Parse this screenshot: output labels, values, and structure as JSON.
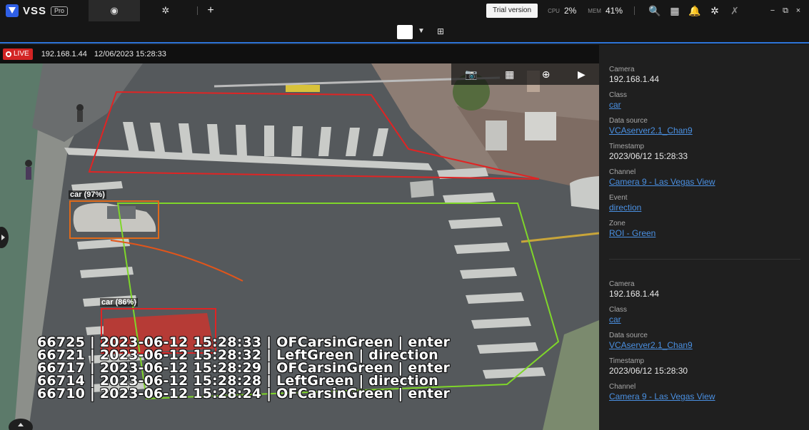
{
  "app": {
    "name": "VSS",
    "edition": "Pro",
    "trial_label": "Trial version",
    "cpu_label": "CPU",
    "cpu_value": "2%",
    "mem_label": "MEM",
    "mem_value": "41%",
    "add_tab_label": "+",
    "accent_color": "#2d74d8"
  },
  "tabs": [
    {
      "icon": "eye-icon",
      "glyph": "◉",
      "active": true
    },
    {
      "icon": "gear-icon",
      "glyph": "✲",
      "active": false
    }
  ],
  "toolbar_icons": [
    {
      "name": "search-icon",
      "glyph": "🔍"
    },
    {
      "name": "grid-icon",
      "glyph": "▦"
    },
    {
      "name": "bell-icon",
      "glyph": "🔔"
    },
    {
      "name": "settings-icon",
      "glyph": "✲"
    },
    {
      "name": "pin-icon",
      "glyph": "✗"
    }
  ],
  "window_controls": [
    {
      "name": "minimize-icon",
      "glyph": "−"
    },
    {
      "name": "restore-icon",
      "glyph": "⧉"
    },
    {
      "name": "close-icon",
      "glyph": "×"
    }
  ],
  "video": {
    "live_label": "LIVE",
    "camera_ip": "192.168.1.44",
    "datetime": "12/06/2023 15:28:33",
    "detections": [
      {
        "label": "car (97%)"
      },
      {
        "label": "car (86%)"
      }
    ],
    "event_log": [
      "66725 | 2023-06-12 15:28:33 | OFCarsinGreen | enter",
      "66721 | 2023-06-12 15:28:32 | LeftGreen | direction",
      "66717 | 2023-06-12 15:28:29 | OFCarsinGreen | enter",
      "66714 | 2023-06-12 15:28:28 | LeftGreen | direction",
      "66710 | 2023-06-12 15:28:24 | OFCarsinGreen | enter"
    ],
    "tools": [
      {
        "name": "snapshot-icon",
        "glyph": "📷"
      },
      {
        "name": "layout-icon",
        "glyph": "▦"
      },
      {
        "name": "zoom-search-icon",
        "glyph": "⊕"
      },
      {
        "name": "play-icon",
        "glyph": "▶"
      }
    ]
  },
  "events": [
    {
      "camera_label": "Camera",
      "camera": "192.168.1.44",
      "class_label": "Class",
      "class": "car",
      "source_label": "Data source",
      "source": "VCAserver2.1_Chan9",
      "timestamp_label": "Timestamp",
      "timestamp": "2023/06/12 15:28:33",
      "channel_label": "Channel",
      "channel": "Camera 9 - Las Vegas View",
      "event_label": "Event",
      "event": "direction",
      "zone_label": "Zone",
      "zone": "ROI - Green"
    },
    {
      "camera_label": "Camera",
      "camera": "192.168.1.44",
      "class_label": "Class",
      "class": "car",
      "source_label": "Data source",
      "source": "VCAserver2.1_Chan9",
      "timestamp_label": "Timestamp",
      "timestamp": "2023/06/12 15:28:30",
      "channel_label": "Channel",
      "channel": "Camera 9 - Las Vegas View"
    }
  ]
}
